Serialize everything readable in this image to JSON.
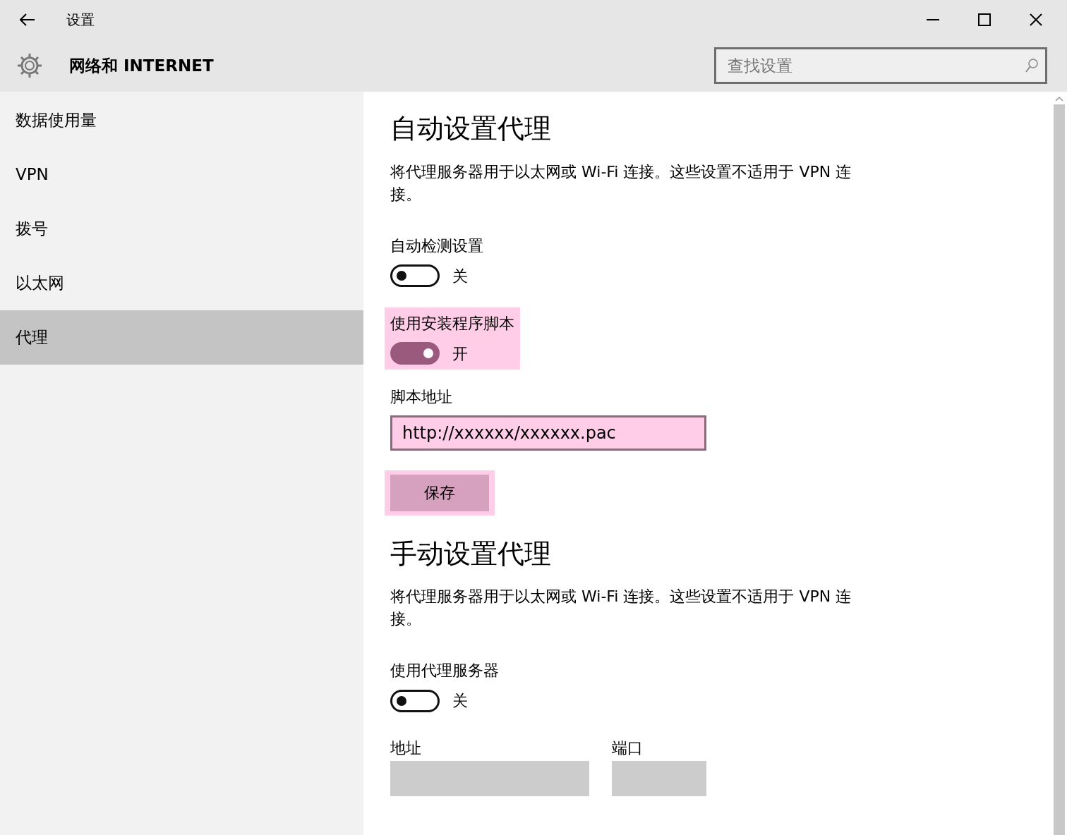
{
  "window": {
    "title": "设置"
  },
  "header": {
    "title": "网络和 INTERNET",
    "search": {
      "placeholder": "查找设置"
    }
  },
  "sidebar": {
    "items": [
      {
        "label": "数据使用量",
        "selected": false
      },
      {
        "label": "VPN",
        "selected": false
      },
      {
        "label": "拨号",
        "selected": false
      },
      {
        "label": "以太网",
        "selected": false
      },
      {
        "label": "代理",
        "selected": true
      }
    ]
  },
  "sections": [
    {
      "heading": "自动设置代理",
      "description": "将代理服务器用于以太网或 Wi-Fi 连接。这些设置不适用于 VPN 连接。",
      "settings": [
        {
          "kind": "toggle",
          "label": "自动检测设置",
          "on": false,
          "state_text": "关"
        },
        {
          "kind": "toggle",
          "label": "使用安装程序脚本",
          "on": true,
          "state_text": "开",
          "highlighted": true
        },
        {
          "kind": "field",
          "label": "脚本地址",
          "value": "http://xxxxxx/xxxxxx.pac",
          "highlighted": true
        },
        {
          "kind": "button",
          "label": "保存",
          "highlighted": true
        }
      ]
    },
    {
      "heading": "手动设置代理",
      "description": "将代理服务器用于以太网或 Wi-Fi 连接。这些设置不适用于 VPN 连接。",
      "settings": [
        {
          "kind": "toggle",
          "label": "使用代理服务器",
          "on": false,
          "state_text": "关"
        },
        {
          "kind": "field_pair",
          "fields": [
            {
              "label": "地址",
              "disabled": true
            },
            {
              "label": "端口",
              "disabled": true
            }
          ]
        }
      ]
    }
  ]
}
